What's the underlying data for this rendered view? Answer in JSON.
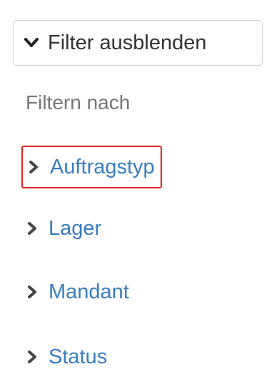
{
  "toggle": {
    "label": "Filter ausblenden",
    "icon": "chevron-down-icon"
  },
  "filter_heading": "Filtern nach",
  "filters": [
    {
      "label": "Auftragstyp",
      "icon": "chevron-right-icon",
      "highlighted": true
    },
    {
      "label": "Lager",
      "icon": "chevron-right-icon"
    },
    {
      "label": "Mandant",
      "icon": "chevron-right-icon"
    },
    {
      "label": "Status",
      "icon": "chevron-right-icon"
    }
  ],
  "colors": {
    "link": "#3a7cc0",
    "heading": "#777777",
    "button_text": "#333333",
    "highlight_border": "#e02424",
    "chevron": "#444444"
  }
}
